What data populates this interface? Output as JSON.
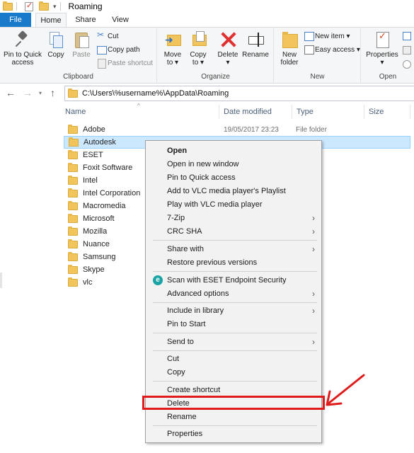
{
  "window": {
    "title": "Roaming"
  },
  "tabs": {
    "file": "File",
    "home": "Home",
    "share": "Share",
    "view": "View"
  },
  "ribbon": {
    "clipboard": {
      "label": "Clipboard",
      "pin_line1": "Pin to Quick",
      "pin_line2": "access",
      "copy": "Copy",
      "paste": "Paste",
      "cut": "Cut",
      "copy_path": "Copy path",
      "paste_shortcut": "Paste shortcut"
    },
    "organize": {
      "label": "Organize",
      "move_line1": "Move",
      "move_line2": "to ▾",
      "copy_line1": "Copy",
      "copy_line2": "to ▾",
      "delete": "Delete",
      "delete_caret": "▾",
      "rename": "Rename"
    },
    "new": {
      "label": "New",
      "newfolder_line1": "New",
      "newfolder_line2": "folder",
      "new_item": "New item ▾",
      "easy_access": "Easy access ▾"
    },
    "open": {
      "label": "Open",
      "properties": "Properties",
      "properties_caret": "▾"
    }
  },
  "nav": {
    "back": "←",
    "forward": "→",
    "up": "↑",
    "address": "C:\\Users\\%username%\\AppData\\Roaming"
  },
  "columns": {
    "name": "Name",
    "date": "Date modified",
    "type": "Type",
    "size": "Size"
  },
  "files": [
    {
      "name": "Adobe",
      "date": "19/05/2017 23:23",
      "type": "File folder",
      "selected": false
    },
    {
      "name": "Autodesk",
      "date": "",
      "type": "",
      "selected": true
    },
    {
      "name": "ESET",
      "date": "",
      "type": "",
      "selected": false
    },
    {
      "name": "Foxit Software",
      "date": "",
      "type": "",
      "selected": false
    },
    {
      "name": "Intel",
      "date": "",
      "type": "",
      "selected": false
    },
    {
      "name": "Intel Corporation",
      "date": "",
      "type": "",
      "selected": false
    },
    {
      "name": "Macromedia",
      "date": "",
      "type": "",
      "selected": false
    },
    {
      "name": "Microsoft",
      "date": "",
      "type": "",
      "selected": false
    },
    {
      "name": "Mozilla",
      "date": "",
      "type": "",
      "selected": false
    },
    {
      "name": "Nuance",
      "date": "",
      "type": "",
      "selected": false
    },
    {
      "name": "Samsung",
      "date": "",
      "type": "",
      "selected": false
    },
    {
      "name": "Skype",
      "date": "",
      "type": "",
      "selected": false
    },
    {
      "name": "vlc",
      "date": "",
      "type": "",
      "selected": false
    }
  ],
  "context_menu": {
    "open": "Open",
    "open_new_window": "Open in new window",
    "pin_quick": "Pin to Quick access",
    "vlc_playlist": "Add to VLC media player's Playlist",
    "vlc_play": "Play with VLC media player",
    "zip": "7-Zip",
    "crc": "CRC SHA",
    "share_with": "Share with",
    "restore": "Restore previous versions",
    "eset_scan": "Scan with ESET Endpoint Security",
    "advanced": "Advanced options",
    "include_library": "Include in library",
    "pin_start": "Pin to Start",
    "send_to": "Send to",
    "cut": "Cut",
    "copy": "Copy",
    "create_shortcut": "Create shortcut",
    "delete": "Delete",
    "rename": "Rename",
    "properties": "Properties",
    "submenu_arrow": "›"
  },
  "annotation": {
    "color": "#e01b1b"
  }
}
